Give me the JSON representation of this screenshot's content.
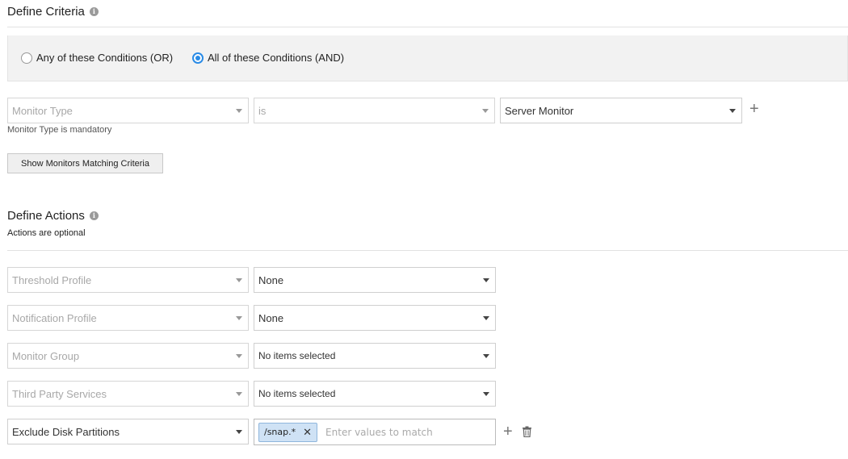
{
  "criteria": {
    "title": "Define Criteria",
    "radio_or": "Any of these Conditions (OR)",
    "radio_and": "All of these Conditions (AND)",
    "selected": "and",
    "row": {
      "field": "Monitor Type",
      "operator": "is",
      "value": "Server Monitor"
    },
    "hint": "Monitor Type is mandatory",
    "show_button": "Show Monitors Matching Criteria"
  },
  "actions": {
    "title": "Define Actions",
    "subtitle": "Actions are optional",
    "rows": [
      {
        "label": "Threshold Profile",
        "value": "None"
      },
      {
        "label": "Notification Profile",
        "value": "None"
      },
      {
        "label": "Monitor Group",
        "value": "No items selected"
      },
      {
        "label": "Third Party Services",
        "value": "No items selected"
      }
    ],
    "exclude": {
      "label": "Exclude Disk Partitions",
      "tag": "/snap.*",
      "placeholder": "Enter values to match"
    }
  },
  "icons": {
    "info": "info-icon",
    "add": "plus-icon",
    "delete": "trash-icon",
    "dropdown": "caret-down-icon",
    "remove_tag": "close-icon"
  }
}
